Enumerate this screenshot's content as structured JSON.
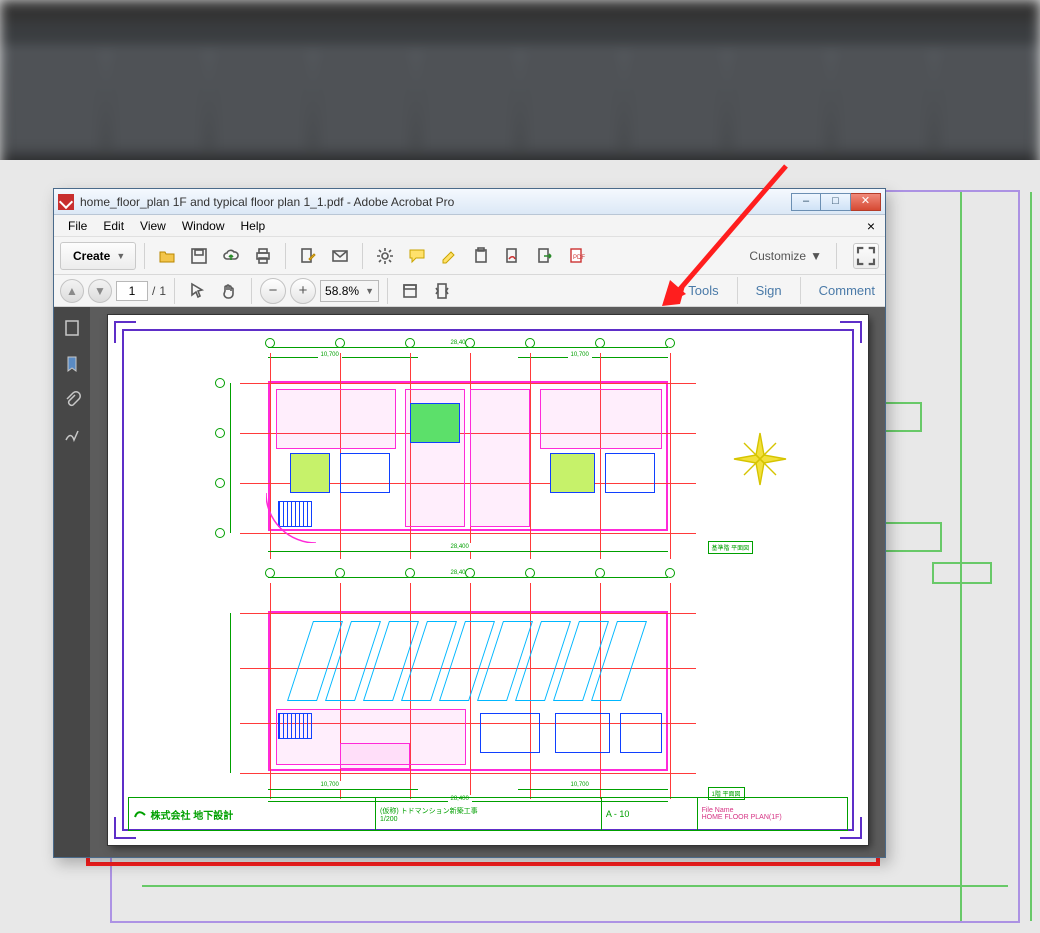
{
  "background_app": "AutoCAD (blurred ribbon)",
  "acrobat": {
    "title": "home_floor_plan 1F and typical floor plan 1_1.pdf - Adobe Acrobat Pro",
    "menu": {
      "file": "File",
      "edit": "Edit",
      "view": "View",
      "window": "Window",
      "help": "Help"
    },
    "toolbar": {
      "create": "Create",
      "customize": "Customize"
    },
    "nav": {
      "page": "1",
      "total": "1",
      "zoom": "58.8%"
    },
    "panes": {
      "tools": "Tools",
      "sign": "Sign",
      "comment": "Comment"
    }
  },
  "drawing": {
    "overall_width_top": "28,400",
    "upper_dim_left": "10,700",
    "upper_dim_right": "10,700",
    "lower_dim_left": "10,700",
    "lower_dim_right": "10,700",
    "overall_width_bottom": "28,400",
    "title_block": {
      "company": "株式会社 地下設計",
      "project": "(仮称) トドマンション新築工事",
      "drawing_no": "A - 10",
      "file_label": "File Name",
      "file_name": "HOME FLOOR PLAN(1F)",
      "scale": "1/200"
    },
    "label_upper": "基準階 平面図",
    "label_lower": "1階 平面図"
  },
  "window_controls": {
    "min": "–",
    "max": "□",
    "close": "✕"
  }
}
